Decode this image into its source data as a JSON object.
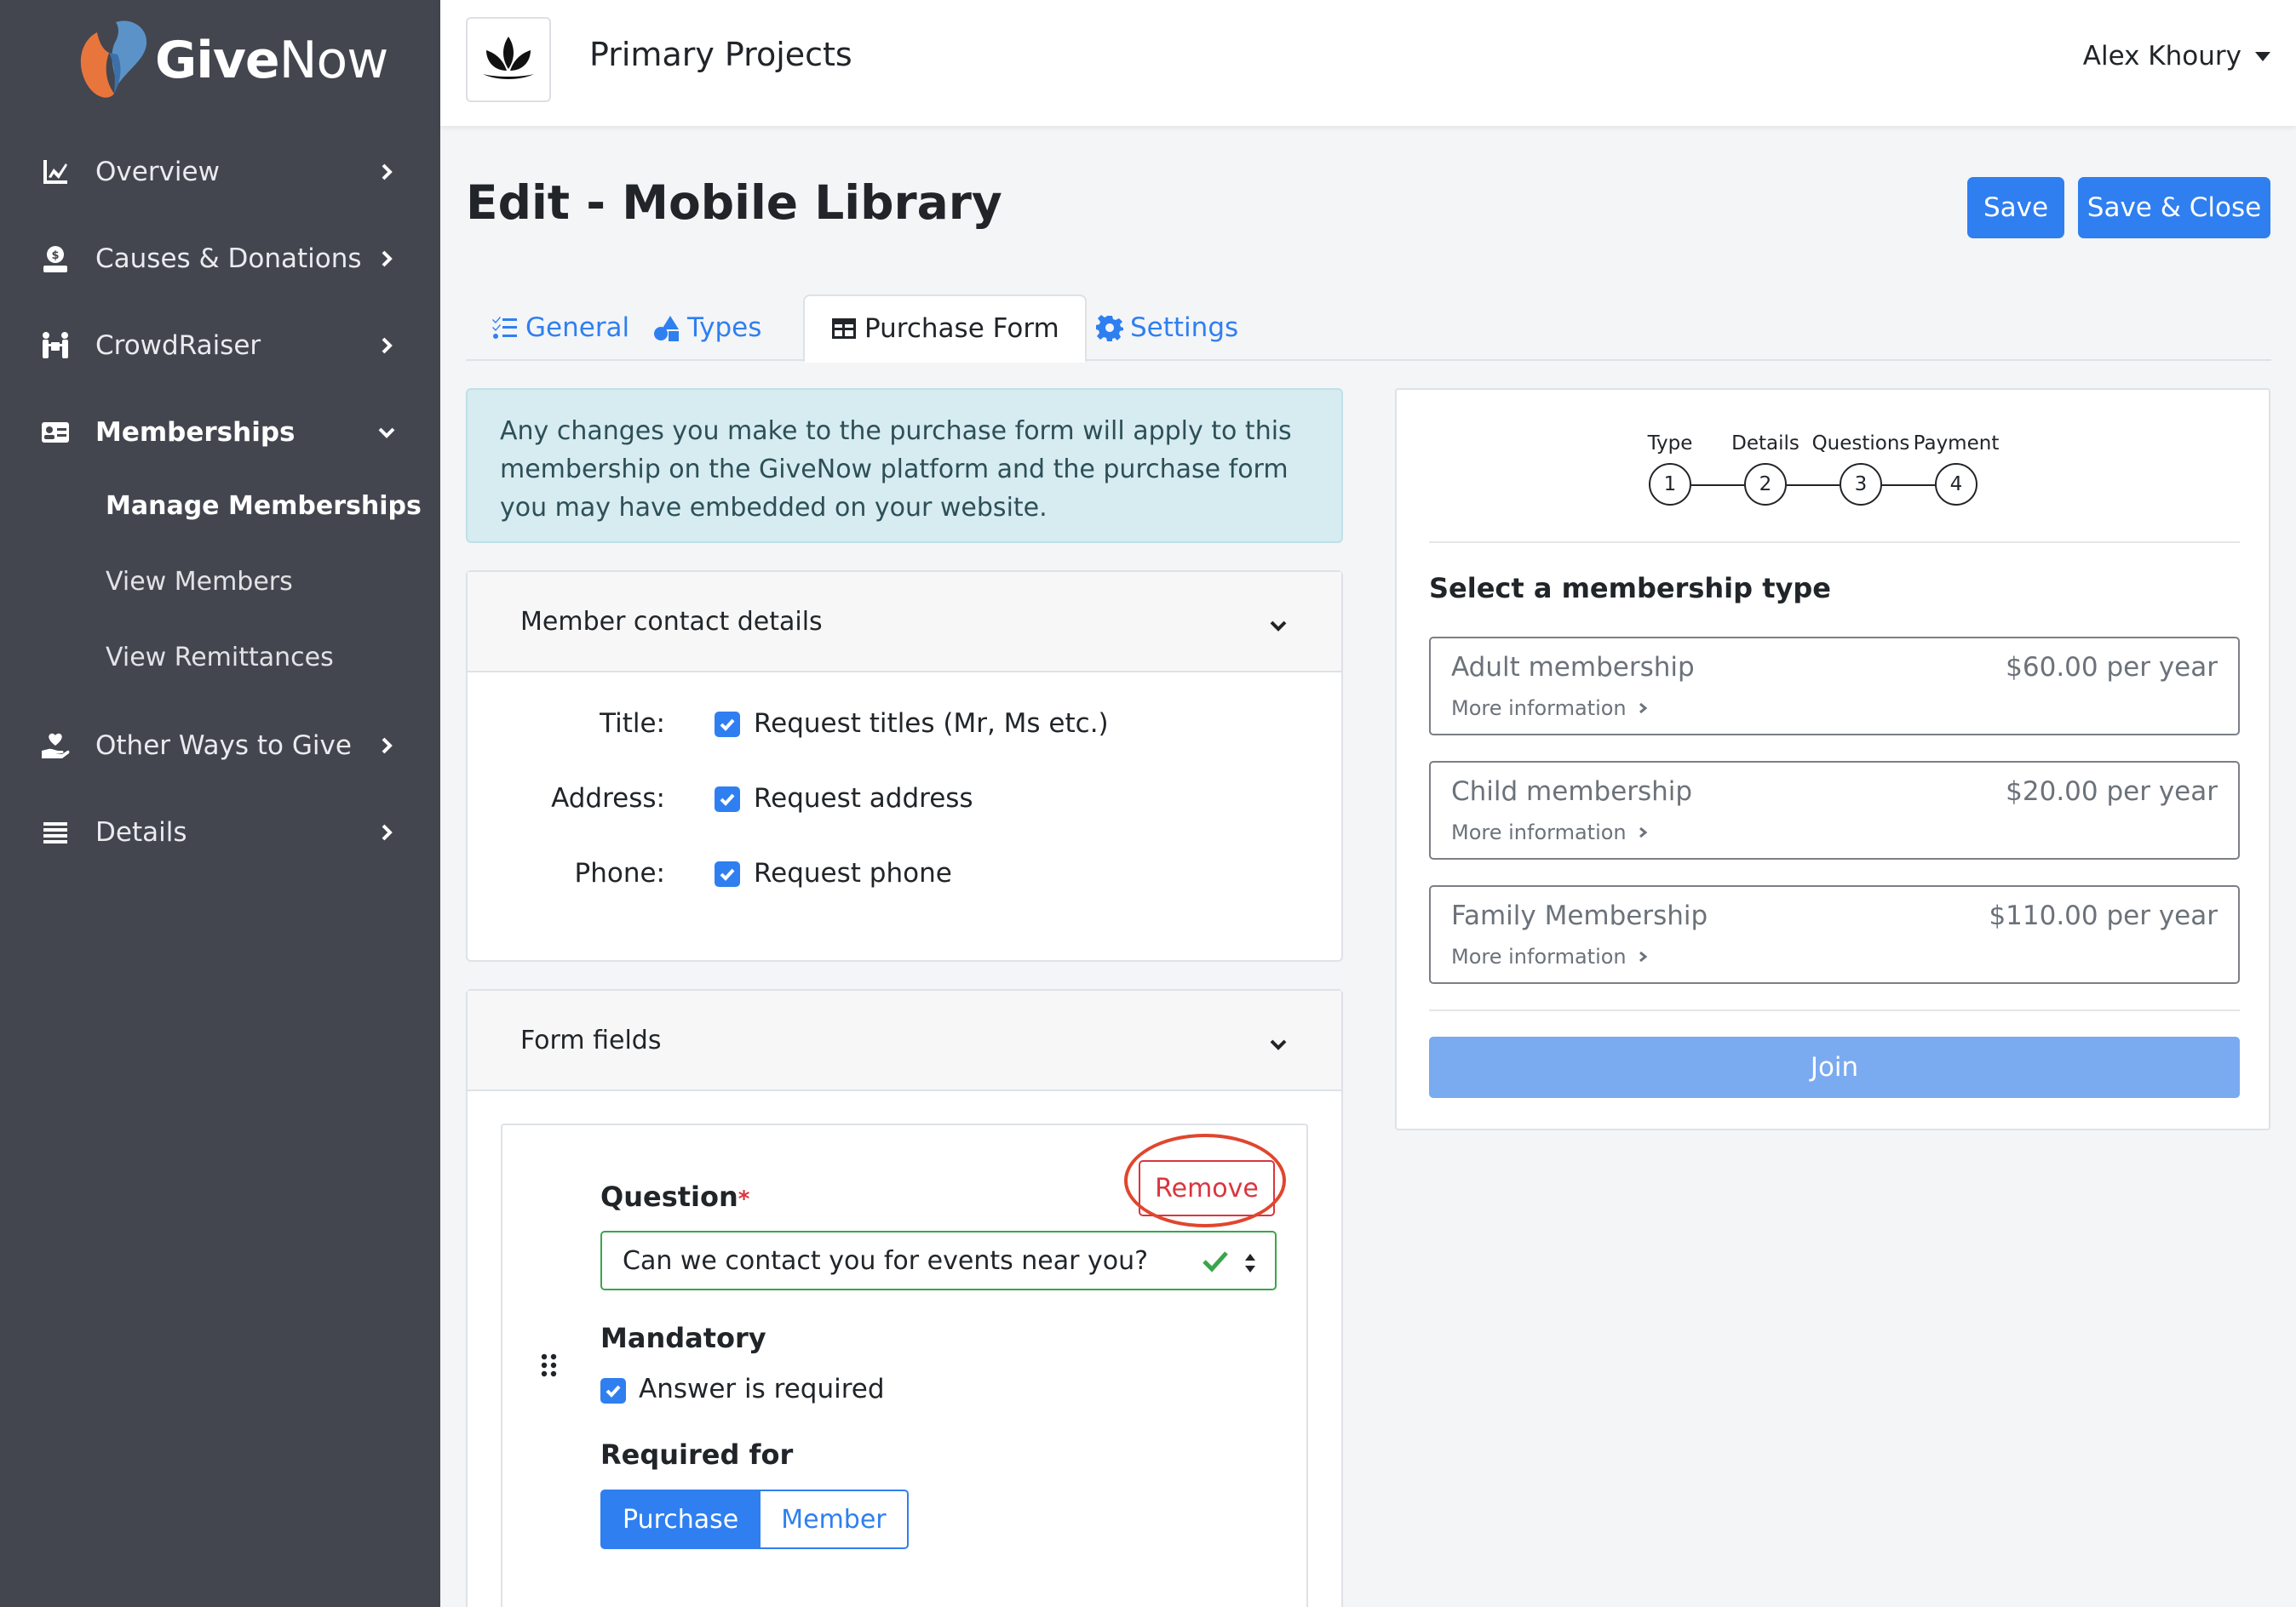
{
  "brand": {
    "name_bold": "Give",
    "name_light": "Now"
  },
  "sidebar": {
    "items": [
      {
        "label": "Overview",
        "icon": "chart-line-icon"
      },
      {
        "label": "Causes & Donations",
        "icon": "donate-icon"
      },
      {
        "label": "CrowdRaiser",
        "icon": "people-carry-icon"
      },
      {
        "label": "Memberships",
        "icon": "id-card-icon"
      },
      {
        "label": "Other Ways to Give",
        "icon": "hand-holding-heart-icon"
      },
      {
        "label": "Details",
        "icon": "list-icon"
      }
    ],
    "subitems": [
      "Manage Memberships",
      "View Members",
      "View Remittances"
    ]
  },
  "topbar": {
    "org_name": "Primary Projects",
    "user_name": "Alex Khoury"
  },
  "page": {
    "title": "Edit - Mobile Library",
    "save_label": "Save",
    "save_close_label": "Save & Close"
  },
  "tabs": [
    {
      "label": "General",
      "icon": "tasks-icon"
    },
    {
      "label": "Types",
      "icon": "shapes-icon"
    },
    {
      "label": "Purchase Form",
      "icon": "table-icon"
    },
    {
      "label": "Settings",
      "icon": "cog-icon"
    }
  ],
  "alert": {
    "text": "Any changes you make to the purchase form will apply to this membership on the GiveNow platform and the purchase form you may have embedded on your website."
  },
  "contact_card": {
    "header": "Member contact details",
    "rows": [
      {
        "label": "Title:",
        "check_label": "Request titles (Mr, Ms etc.)"
      },
      {
        "label": "Address:",
        "check_label": "Request address"
      },
      {
        "label": "Phone:",
        "check_label": "Request phone"
      }
    ]
  },
  "form_fields_card": {
    "header": "Form fields",
    "question_label": "Question",
    "required_marker": "*",
    "question_value": "Can we contact you for events near you?",
    "remove_label": "Remove",
    "mandatory_label": "Mandatory",
    "mandatory_check": "Answer is required",
    "required_for_label": "Required for",
    "required_for_options": [
      "Purchase",
      "Member"
    ]
  },
  "preview": {
    "steps": [
      {
        "label": "Type",
        "num": "1"
      },
      {
        "label": "Details",
        "num": "2"
      },
      {
        "label": "Questions",
        "num": "3"
      },
      {
        "label": "Payment",
        "num": "4"
      }
    ],
    "heading": "Select a membership type",
    "types": [
      {
        "name": "Adult membership",
        "price": "$60.00 per year",
        "more": "More information"
      },
      {
        "name": "Child membership",
        "price": "$20.00 per year",
        "more": "More information"
      },
      {
        "name": "Family Membership",
        "price": "$110.00 per year",
        "more": "More information"
      }
    ],
    "join_label": "Join"
  },
  "colors": {
    "primary": "#2f7ff0",
    "sidebar": "#43464f",
    "danger": "#d9363e",
    "success": "#3aa54a"
  }
}
